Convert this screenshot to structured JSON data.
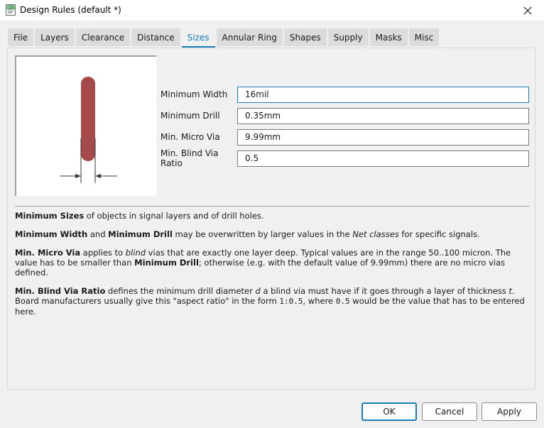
{
  "window": {
    "title": "Design Rules (default *)",
    "app_icon": "eagle-brd-icon",
    "close_icon": "close-icon"
  },
  "tabs": [
    {
      "label": "File",
      "active": false
    },
    {
      "label": "Layers",
      "active": false
    },
    {
      "label": "Clearance",
      "active": false
    },
    {
      "label": "Distance",
      "active": false
    },
    {
      "label": "Sizes",
      "active": true
    },
    {
      "label": "Annular Ring",
      "active": false
    },
    {
      "label": "Shapes",
      "active": false
    },
    {
      "label": "Supply",
      "active": false
    },
    {
      "label": "Masks",
      "active": false
    },
    {
      "label": "Misc",
      "active": false
    }
  ],
  "preview": {
    "description": "trace-width-diagram",
    "trace_color": "#a54a4a"
  },
  "fields": [
    {
      "label": "Minimum Width",
      "value": "16mil",
      "focused": true
    },
    {
      "label": "Minimum Drill",
      "value": "0.35mm",
      "focused": false
    },
    {
      "label": "Min. Micro Via",
      "value": "9.99mm",
      "focused": false
    },
    {
      "label": "Min. Blind Via Ratio",
      "value": "0.5",
      "focused": false
    }
  ],
  "help": {
    "p1": {
      "b1": "Minimum Sizes",
      "t1": " of objects in signal layers and of drill holes."
    },
    "p2": {
      "b1": "Minimum Width",
      "t1": " and ",
      "b2": "Minimum Drill",
      "t2": " may be overwritten by larger values in the ",
      "i1": "Net classes",
      "t3": " for specific signals."
    },
    "p3": {
      "b1": "Min. Micro Via",
      "t1": " applies to ",
      "i1": "blind",
      "t2": " vias that are exactly one layer deep. Typical values are in the range 50..100 micron. The value has to be smaller than ",
      "b2": "Minimum Drill",
      "t3": "; otherwise (e.g. with the default value of 9.99mm) there are no micro vias defined."
    },
    "p4": {
      "b1": "Min. Blind Via Ratio",
      "t1": " defines the minimum drill diameter ",
      "i1": "d",
      "t2": " a blind via must have if it goes through a layer of thickness ",
      "i2": "t",
      "t3": ". Board manufacturers usually give this \"aspect ratio\" in the form ",
      "c1": "1:0.5",
      "t4": ", where ",
      "c2": "0.5",
      "t5": " would be the value that has to be entered here."
    }
  },
  "buttons": {
    "ok": "OK",
    "cancel": "Cancel",
    "apply": "Apply"
  },
  "colors": {
    "accent": "#1a7dbb",
    "trace": "#a54a4a"
  }
}
